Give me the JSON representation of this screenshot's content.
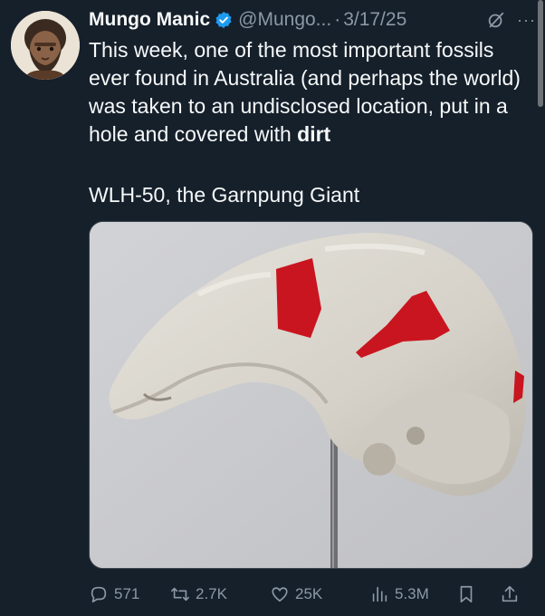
{
  "tweet": {
    "author_name": "Mungo Manic",
    "handle": "@Mungo...",
    "separator": "·",
    "date": "3/17/25",
    "more": "···",
    "body_main": "This week, one of the most important fossils ever found in Australia (and perhaps the world) was taken to an undisclosed location, put in a hole and covered with",
    "body_bold": "dirt",
    "caption": "WLH-50, the Garnpung Giant"
  },
  "actions": {
    "replies": "571",
    "retweets": "2.7K",
    "likes": "25K",
    "views": "5.3M"
  },
  "icons": [
    "verified-badge-icon",
    "grok-icon",
    "more-icon",
    "reply-icon",
    "retweet-icon",
    "like-icon",
    "views-icon",
    "bookmark-icon",
    "share-icon"
  ],
  "colors": {
    "background": "#15202b",
    "text": "#f7f9f9",
    "muted": "#8b98a5",
    "verified": "#1d9bf0"
  }
}
